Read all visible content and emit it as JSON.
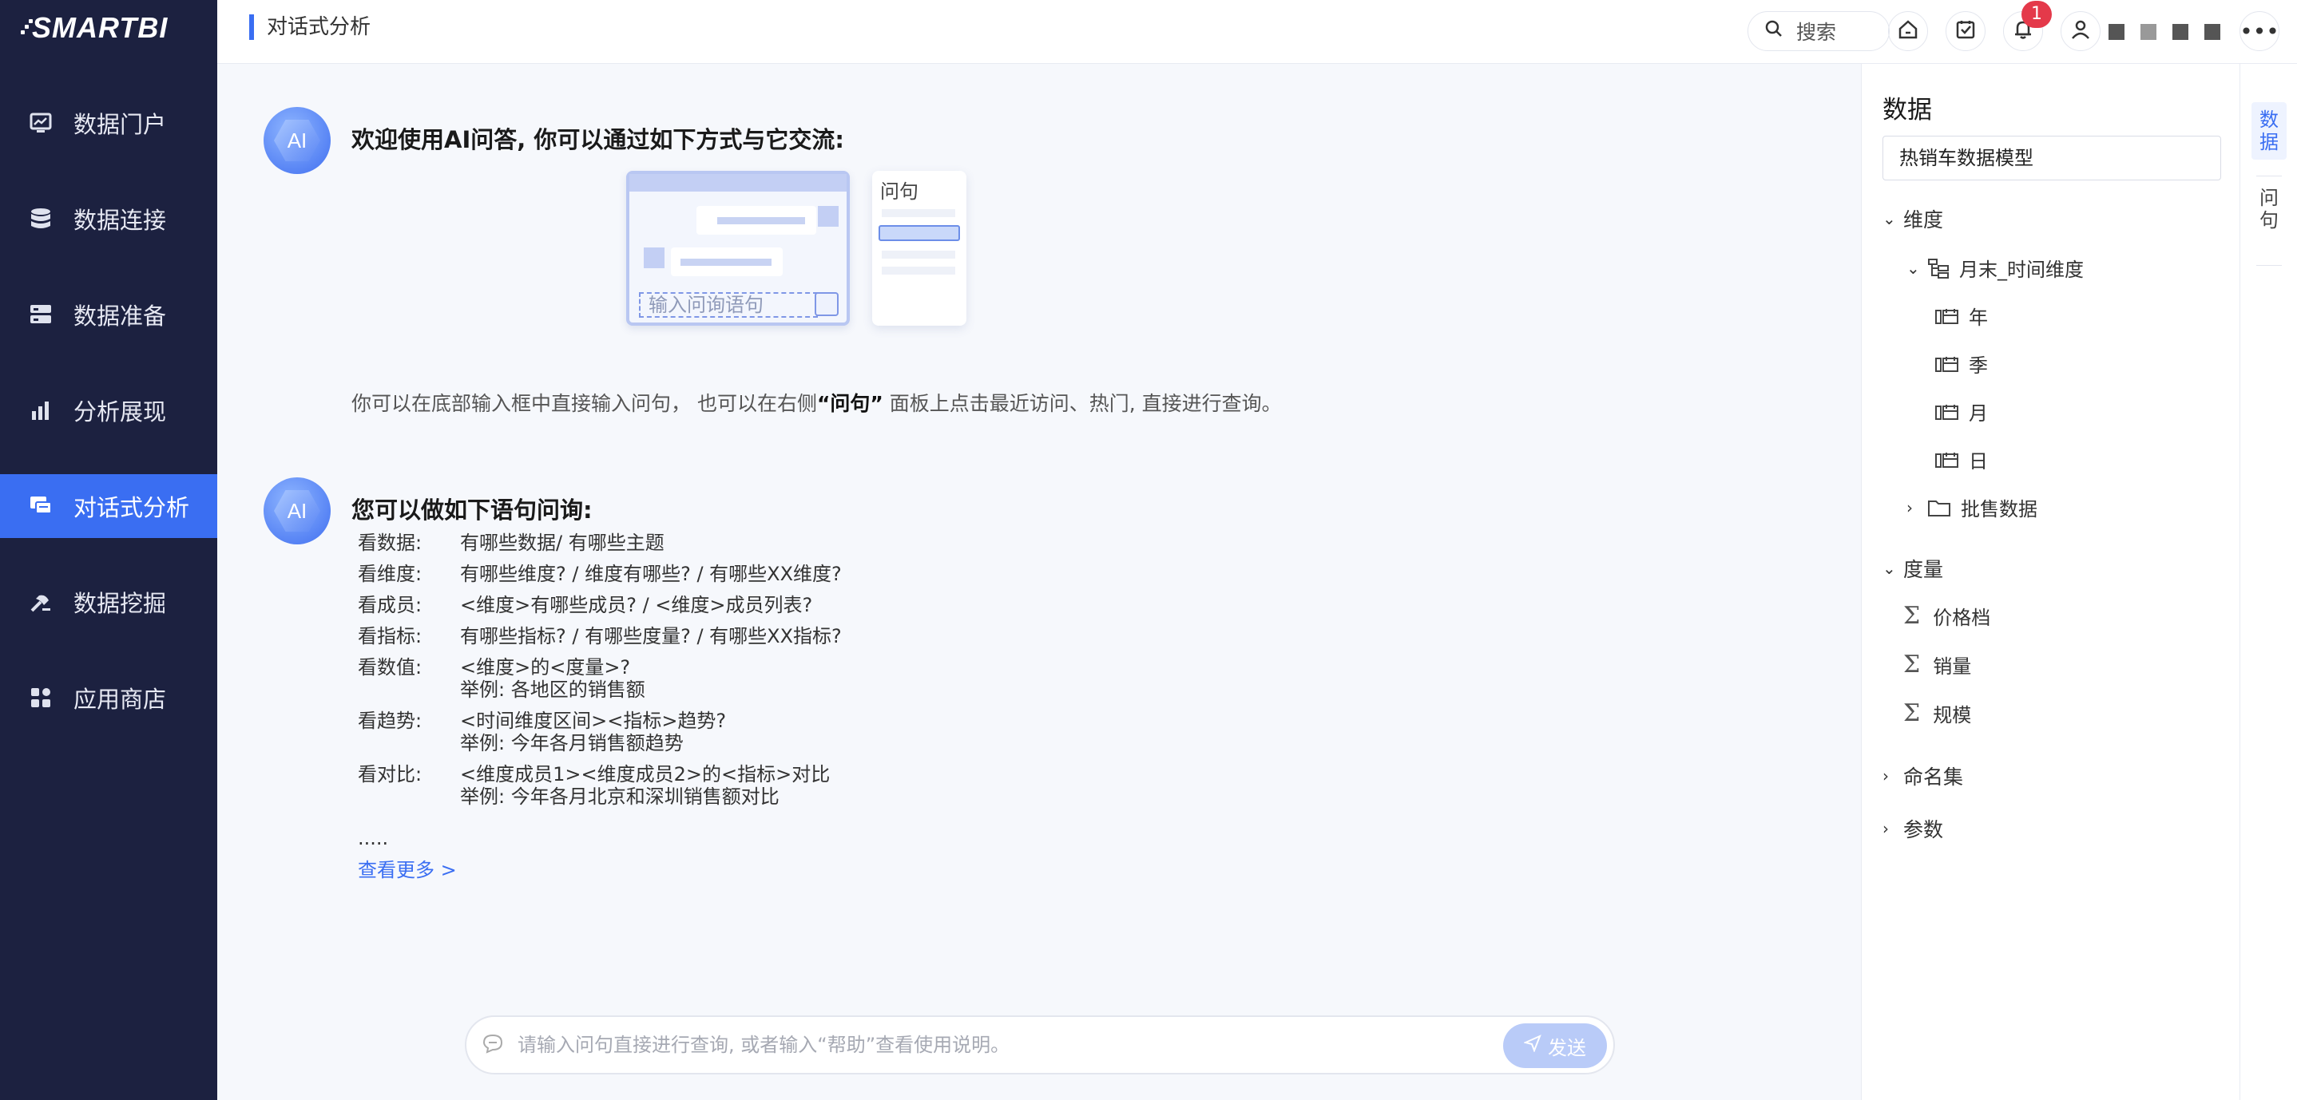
{
  "brand": "SMARTBI",
  "sidebar": {
    "items": [
      {
        "label": "数据门户",
        "icon": "monitor-chart-icon"
      },
      {
        "label": "数据连接",
        "icon": "database-icon"
      },
      {
        "label": "数据准备",
        "icon": "server-icon"
      },
      {
        "label": "分析展现",
        "icon": "bar-chart-icon"
      },
      {
        "label": "对话式分析",
        "icon": "chat-icon",
        "active": true
      },
      {
        "label": "数据挖掘",
        "icon": "pickaxe-icon"
      },
      {
        "label": "应用商店",
        "icon": "apps-icon"
      }
    ]
  },
  "header": {
    "title": "对话式分析",
    "search_label": "搜索",
    "notification_count": "1"
  },
  "welcome": {
    "avatar_text": "AI",
    "title": "欢迎使用AI问答, 你可以通过如下方式与它交流:",
    "illus_input": "输入问询语句",
    "illus_panel_title": "问句",
    "hint_part1": "你可以在底部输入框中直接输入问句，  也可以在右侧",
    "hint_bold": "“问句”",
    "hint_part2": " 面板上点击最近访问、热门, 直接进行查询。"
  },
  "examples": {
    "avatar_text": "AI",
    "title": "您可以做如下语句问询:",
    "rows": [
      {
        "k": "看数据:",
        "v": "有哪些数据/ 有哪些主题"
      },
      {
        "k": "看维度:",
        "v": "有哪些维度? / 维度有哪些? / 有哪些XX维度?"
      },
      {
        "k": "看成员:",
        "v": "<维度>有哪些成员? / <维度>成员列表?"
      },
      {
        "k": "看指标:",
        "v": "有哪些指标? / 有哪些度量? / 有哪些XX指标?"
      },
      {
        "k": "看数值:",
        "v": "<维度>的<度量>?",
        "v2": "举例: 各地区的销售额"
      },
      {
        "k": "看趋势:",
        "v": "<时间维度区间><指标>趋势?",
        "v2": "举例: 今年各月销售额趋势"
      },
      {
        "k": "看对比:",
        "v": "<维度成员1><维度成员2>的<指标>对比",
        "v2": "举例: 今年各月北京和深圳销售额对比"
      }
    ],
    "ellipsis": ".....",
    "see_more": "查看更多 >"
  },
  "ask": {
    "placeholder": "请输入问句直接进行查询, 或者输入“帮助”查看使用说明。",
    "send_label": "发送"
  },
  "right_panel": {
    "title": "数据",
    "model": "热销车数据模型",
    "dimension_label": "维度",
    "time_dimension": "月末_时间维度",
    "time_levels": [
      "年",
      "季",
      "月",
      "日"
    ],
    "batch_data": "批售数据",
    "measure_label": "度量",
    "measures": [
      "价格档",
      "销量",
      "规模"
    ],
    "named_set_label": "命名集",
    "param_label": "参数"
  },
  "side_tabs": {
    "data": "数据",
    "question": "问句"
  },
  "colors": {
    "sidebar_bg": "#1c2140",
    "accent": "#3a6ef2",
    "badge": "#e4394a"
  }
}
